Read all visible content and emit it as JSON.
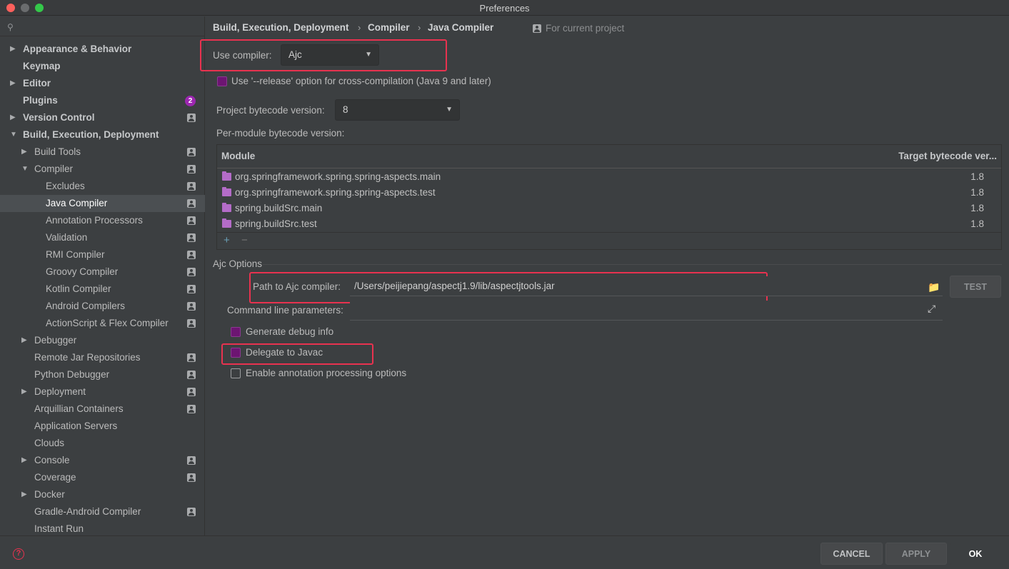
{
  "window": {
    "title": "Preferences"
  },
  "search": {
    "placeholder": ""
  },
  "sidebar": {
    "items": [
      {
        "label": "Appearance & Behavior",
        "arrow": "▶",
        "bold": true,
        "level": 0,
        "project": false
      },
      {
        "label": "Keymap",
        "arrow": "",
        "bold": true,
        "level": 0,
        "project": false
      },
      {
        "label": "Editor",
        "arrow": "▶",
        "bold": true,
        "level": 0,
        "project": false
      },
      {
        "label": "Plugins",
        "arrow": "",
        "bold": true,
        "level": 0,
        "project": false,
        "badge": "2"
      },
      {
        "label": "Version Control",
        "arrow": "▶",
        "bold": true,
        "level": 0,
        "project": true
      },
      {
        "label": "Build, Execution, Deployment",
        "arrow": "▼",
        "bold": true,
        "level": 0,
        "project": false
      },
      {
        "label": "Build Tools",
        "arrow": "▶",
        "bold": false,
        "level": 1,
        "project": true
      },
      {
        "label": "Compiler",
        "arrow": "▼",
        "bold": false,
        "level": 1,
        "project": true
      },
      {
        "label": "Excludes",
        "arrow": "",
        "bold": false,
        "level": 2,
        "project": true
      },
      {
        "label": "Java Compiler",
        "arrow": "",
        "bold": false,
        "level": 2,
        "project": true,
        "selected": true
      },
      {
        "label": "Annotation Processors",
        "arrow": "",
        "bold": false,
        "level": 2,
        "project": true
      },
      {
        "label": "Validation",
        "arrow": "",
        "bold": false,
        "level": 2,
        "project": true
      },
      {
        "label": "RMI Compiler",
        "arrow": "",
        "bold": false,
        "level": 2,
        "project": true
      },
      {
        "label": "Groovy Compiler",
        "arrow": "",
        "bold": false,
        "level": 2,
        "project": true
      },
      {
        "label": "Kotlin Compiler",
        "arrow": "",
        "bold": false,
        "level": 2,
        "project": true
      },
      {
        "label": "Android Compilers",
        "arrow": "",
        "bold": false,
        "level": 2,
        "project": true
      },
      {
        "label": "ActionScript & Flex Compiler",
        "arrow": "",
        "bold": false,
        "level": 2,
        "project": true
      },
      {
        "label": "Debugger",
        "arrow": "▶",
        "bold": false,
        "level": 1,
        "project": false
      },
      {
        "label": "Remote Jar Repositories",
        "arrow": "",
        "bold": false,
        "level": 1,
        "project": true
      },
      {
        "label": "Python Debugger",
        "arrow": "",
        "bold": false,
        "level": 1,
        "project": true
      },
      {
        "label": "Deployment",
        "arrow": "▶",
        "bold": false,
        "level": 1,
        "project": true
      },
      {
        "label": "Arquillian Containers",
        "arrow": "",
        "bold": false,
        "level": 1,
        "project": true
      },
      {
        "label": "Application Servers",
        "arrow": "",
        "bold": false,
        "level": 1,
        "project": false
      },
      {
        "label": "Clouds",
        "arrow": "",
        "bold": false,
        "level": 1,
        "project": false
      },
      {
        "label": "Console",
        "arrow": "▶",
        "bold": false,
        "level": 1,
        "project": true
      },
      {
        "label": "Coverage",
        "arrow": "",
        "bold": false,
        "level": 1,
        "project": true
      },
      {
        "label": "Docker",
        "arrow": "▶",
        "bold": false,
        "level": 1,
        "project": false
      },
      {
        "label": "Gradle-Android Compiler",
        "arrow": "",
        "bold": false,
        "level": 1,
        "project": true
      },
      {
        "label": "Instant Run",
        "arrow": "",
        "bold": false,
        "level": 1,
        "project": false
      }
    ]
  },
  "breadcrumb": {
    "parts": [
      "Build, Execution, Deployment",
      "Compiler",
      "Java Compiler"
    ],
    "separator": "›",
    "scope": "For current project"
  },
  "compiler": {
    "use_compiler_label": "Use compiler:",
    "use_compiler_value": "Ajc",
    "release_option_label": "Use '--release' option for cross-compilation (Java 9 and later)",
    "release_option_checked": true,
    "bytecode_label": "Project bytecode version:",
    "bytecode_value": "8",
    "per_module_label": "Per-module bytecode version:"
  },
  "module_table": {
    "headers": {
      "module": "Module",
      "target": "Target bytecode ver..."
    },
    "rows": [
      {
        "module": "org.springframework.spring.spring-aspects.main",
        "version": "1.8"
      },
      {
        "module": "org.springframework.spring.spring-aspects.test",
        "version": "1.8"
      },
      {
        "module": "spring.buildSrc.main",
        "version": "1.8"
      },
      {
        "module": "spring.buildSrc.test",
        "version": "1.8"
      }
    ],
    "add": "+",
    "remove": "−"
  },
  "ajc": {
    "group_title": "Ajc Options",
    "path_label": "Path to Ajc compiler:",
    "path_value": "/Users/peijiepang/aspectj1.9/lib/aspectjtools.jar",
    "test_label": "TEST",
    "cmd_label": "Command line parameters:",
    "cmd_value": "",
    "debug_label": "Generate debug info",
    "debug_checked": true,
    "delegate_label": "Delegate to Javac",
    "delegate_checked": true,
    "annotation_label": "Enable annotation processing options",
    "annotation_checked": false
  },
  "footer": {
    "help": "?",
    "cancel": "CANCEL",
    "apply": "APPLY",
    "ok": "OK"
  },
  "colors": {
    "background": "#3c3f41",
    "selected_row": "#4b4f52",
    "highlight": "#e8324f",
    "checkbox_on": "#6d1572",
    "badge": "#9c27b0",
    "module_folder": "#b46cc8"
  },
  "icons": {
    "search": "search-icon",
    "project_scope": "project-scope-icon",
    "folder": "folder-icon",
    "expand": "expand-icon",
    "help": "help-icon"
  }
}
